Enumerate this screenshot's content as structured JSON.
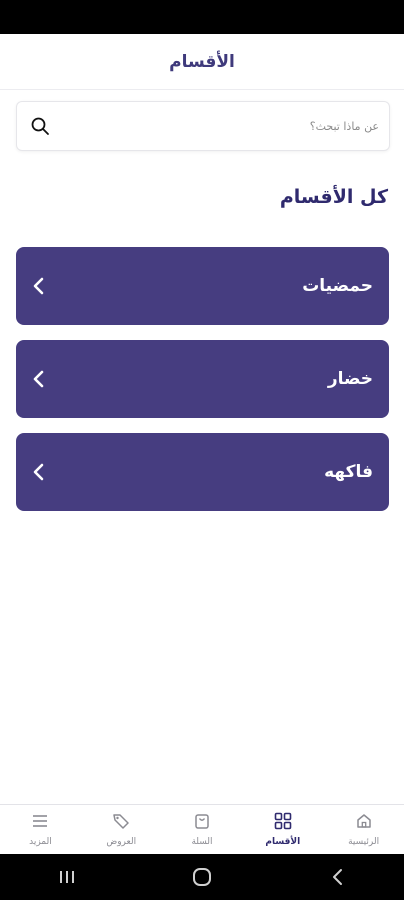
{
  "header": {
    "title": "الأقسام"
  },
  "search": {
    "placeholder": "عن ماذا تبحث؟",
    "icon": "search-icon"
  },
  "section": {
    "title": "كل الأقسام"
  },
  "categories": [
    {
      "label": "حمضيات"
    },
    {
      "label": "خضار"
    },
    {
      "label": "فاكهه"
    }
  ],
  "bottom_nav": {
    "items": [
      {
        "label": "الرئيسية",
        "icon": "home-icon",
        "active": false
      },
      {
        "label": "الأقسام",
        "icon": "grid-icon",
        "active": true
      },
      {
        "label": "السلة",
        "icon": "bag-icon",
        "active": false
      },
      {
        "label": "العروض",
        "icon": "tag-icon",
        "active": false
      },
      {
        "label": "المزيد",
        "icon": "menu-icon",
        "active": false
      }
    ]
  },
  "colors": {
    "primary": "#463d80",
    "title_text": "#2f2a6e",
    "inactive_nav": "#8b8b92"
  }
}
